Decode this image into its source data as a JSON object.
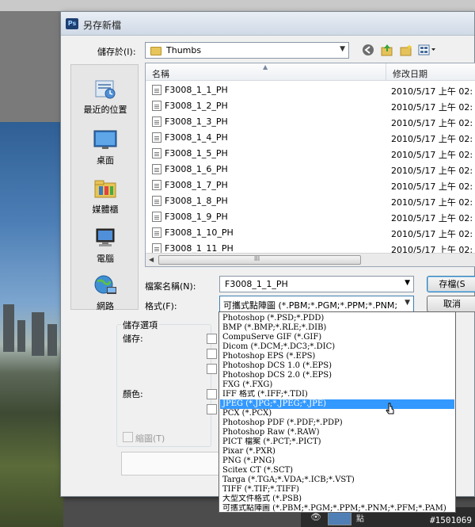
{
  "dialog": {
    "title": "另存新檔",
    "app_icon": "Ps"
  },
  "save_in": {
    "label": "儲存於(I):",
    "value": "Thumbs"
  },
  "places": [
    {
      "label": "最近的位置",
      "icon": "recent-places-icon"
    },
    {
      "label": "桌面",
      "icon": "desktop-icon"
    },
    {
      "label": "媒體櫃",
      "icon": "libraries-icon"
    },
    {
      "label": "電腦",
      "icon": "computer-icon"
    },
    {
      "label": "網路",
      "icon": "network-icon"
    }
  ],
  "file_list": {
    "col_name": "名稱",
    "col_date": "修改日期",
    "files": [
      {
        "name": "F3008_1_1_PH",
        "date": "2010/5/17 上午 02:"
      },
      {
        "name": "F3008_1_2_PH",
        "date": "2010/5/17 上午 02:"
      },
      {
        "name": "F3008_1_3_PH",
        "date": "2010/5/17 上午 02:"
      },
      {
        "name": "F3008_1_4_PH",
        "date": "2010/5/17 上午 02:"
      },
      {
        "name": "F3008_1_5_PH",
        "date": "2010/5/17 上午 02:"
      },
      {
        "name": "F3008_1_6_PH",
        "date": "2010/5/17 上午 02:"
      },
      {
        "name": "F3008_1_7_PH",
        "date": "2010/5/17 上午 02:"
      },
      {
        "name": "F3008_1_8_PH",
        "date": "2010/5/17 上午 02:"
      },
      {
        "name": "F3008_1_9_PH",
        "date": "2010/5/17 上午 02:"
      },
      {
        "name": "F3008_1_10_PH",
        "date": "2010/5/17 上午 02:"
      },
      {
        "name": "F3008_1_11_PH",
        "date": "2010/5/17 上午 02:"
      }
    ],
    "scroll_grip": "III"
  },
  "filename": {
    "label": "檔案名稱(N):",
    "value": "F3008_1_1_PH"
  },
  "format": {
    "label": "格式(F):",
    "value": "可攜式點陣圖 (*.PBM;*.PGM;*.PPM;*.PNM;"
  },
  "buttons": {
    "save": "存檔(S",
    "cancel": "取消"
  },
  "options": {
    "group_title": "儲存選項",
    "save_label": "儲存:",
    "color_label": "顏色:",
    "thumbnail_label": "縮圖(T)"
  },
  "format_options": [
    "Photoshop (*.PSD;*.PDD)",
    "BMP (*.BMP;*.RLE;*.DIB)",
    "CompuServe GIF (*.GIF)",
    "Dicom (*.DCM;*.DC3;*.DIC)",
    "Photoshop EPS (*.EPS)",
    "Photoshop DCS 1.0 (*.EPS)",
    "Photoshop DCS 2.0 (*.EPS)",
    "FXG (*.FXG)",
    "IFF 格式 (*.IFF;*.TDI)",
    "JPEG (*.JPG;*.JPEG;*.JPE)",
    "PCX (*.PCX)",
    "Photoshop PDF (*.PDF;*.PDP)",
    "Photoshop Raw (*.RAW)",
    "PICT 檔案 (*.PCT;*.PICT)",
    "Pixar (*.PXR)",
    "PNG (*.PNG)",
    "Scitex CT (*.SCT)",
    "Targa (*.TGA;*.VDA;*.ICB;*.VST)",
    "TIFF (*.TIF;*.TIFF)",
    "大型文件格式 (*.PSB)",
    "可攜式點陣圖 (*.PBM;*.PGM;*.PPM;*.PNM;*.PFM;*.PAM)"
  ],
  "selected_format_index": 9,
  "background": {
    "layer_label": "點",
    "watermark": "#1501069"
  },
  "colors": {
    "selection": "#3399ff",
    "title_text": "#222222"
  }
}
